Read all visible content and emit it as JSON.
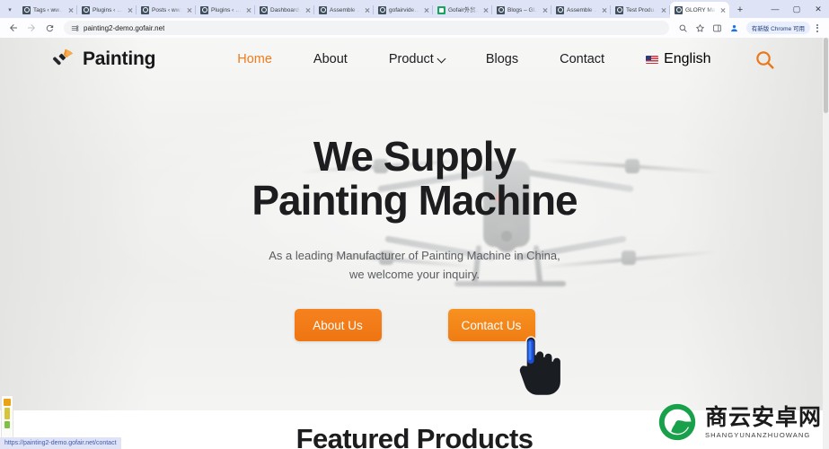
{
  "browser": {
    "tabs": [
      {
        "title": "Tags ‹ ww…",
        "favicon": "wp",
        "active": false
      },
      {
        "title": "Plugins ‹ …",
        "favicon": "wp",
        "active": false
      },
      {
        "title": "Posts ‹ ww…",
        "favicon": "wp",
        "active": false
      },
      {
        "title": "Plugins ‹ …",
        "favicon": "wp",
        "active": false
      },
      {
        "title": "Dashboard…",
        "favicon": "wp",
        "active": false
      },
      {
        "title": "Assemble …",
        "favicon": "wp",
        "active": false
      },
      {
        "title": "gofairvide…",
        "favicon": "wp",
        "active": false
      },
      {
        "title": "Gofair外贸…",
        "favicon": "green",
        "active": false
      },
      {
        "title": "Blogs – Gl…",
        "favicon": "wp",
        "active": false
      },
      {
        "title": "Assemble …",
        "favicon": "wp",
        "active": false
      },
      {
        "title": "Test Produ…",
        "favicon": "wp",
        "active": false
      },
      {
        "title": "GLORY Ma…",
        "favicon": "wp",
        "active": true
      }
    ],
    "new_tab_label": "+",
    "tab_search_label": "▾",
    "window_controls": {
      "minimize": "—",
      "maximize": "▢",
      "close": "✕"
    },
    "toolbar": {
      "back_label": "←",
      "forward_label": "→",
      "reload_label": "⟳",
      "url": "painting2-demo.gofair.net",
      "update_chip": "有新版 Chrome 可用"
    },
    "status_bar": {
      "url": "https://painting2-demo.gofair.net/contact"
    }
  },
  "site": {
    "brand": {
      "name": "Painting",
      "icon": "paintbrush-icon"
    },
    "nav": [
      {
        "label": "Home",
        "active": true,
        "caret": false
      },
      {
        "label": "About",
        "active": false,
        "caret": false
      },
      {
        "label": "Product",
        "active": false,
        "caret": true
      },
      {
        "label": "Blogs",
        "active": false,
        "caret": false
      },
      {
        "label": "Contact",
        "active": false,
        "caret": false
      }
    ],
    "language": {
      "label": "English",
      "flag": "us-flag-icon"
    },
    "search_icon": "search-icon",
    "hero": {
      "title_line1": "We Supply",
      "title_line2": "Painting Machine",
      "subtitle_line1": "As a leading Manufacturer of Painting Machine in China,",
      "subtitle_line2": "we welcome your inquiry.",
      "primary_button": "About Us",
      "secondary_button": "Contact Us"
    },
    "featured": {
      "title": "Featured Products"
    }
  },
  "watermark": {
    "cn": "商云安卓网",
    "en": "SHANGYUNANZHUOWANG"
  },
  "colors": {
    "accent_orange": "#f07c1e",
    "button_orange": "#f5821f",
    "heading_dark": "#1d1d1f",
    "watermark_green": "#19a04a",
    "link_blue": "#3d5ab5"
  }
}
